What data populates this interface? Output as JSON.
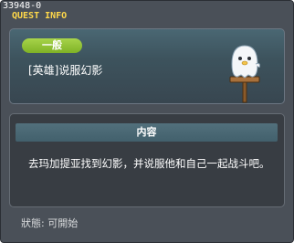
{
  "window": {
    "quest_id": "33948-0",
    "title": "QUEST INFO"
  },
  "quest": {
    "category": "一般",
    "name": "[英雄]说服幻影",
    "npc_icon": "white-ghost-on-signpost"
  },
  "content": {
    "header": "内容",
    "description": "去玛加提亚找到幻影，并说服他和自己一起战斗吧。"
  },
  "status": {
    "label": "狀態: 可開始"
  },
  "colors": {
    "title_accent": "#ffd84a",
    "category_badge": "#8cc234",
    "window_bg": "#4a5058"
  }
}
